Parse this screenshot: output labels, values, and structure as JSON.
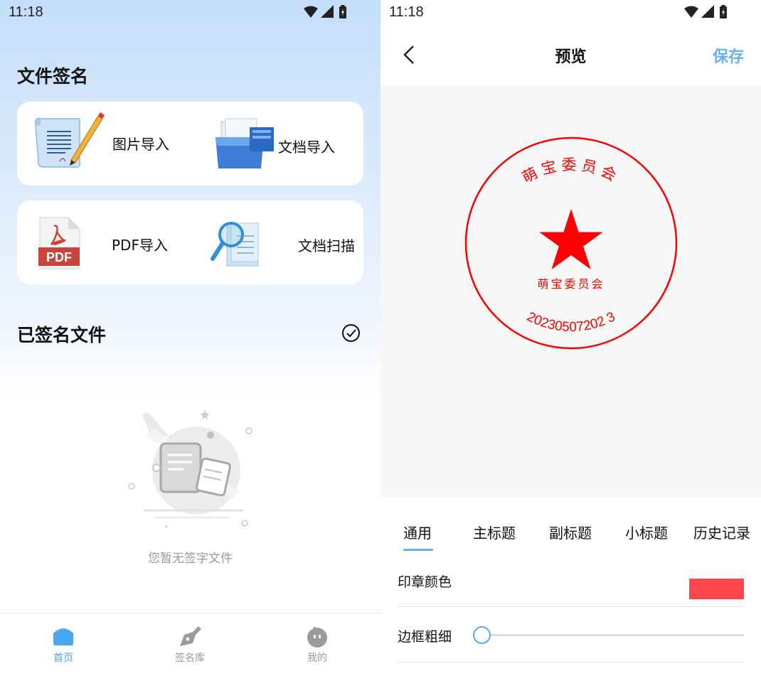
{
  "left": {
    "status": {
      "time": "11:18"
    },
    "file_sign": {
      "title": "文件签名",
      "items": [
        {
          "label": "图片导入",
          "icon": "image-import-icon"
        },
        {
          "label": "文档导入",
          "icon": "folder-import-icon"
        },
        {
          "label": "PDF导入",
          "icon": "pdf-icon"
        },
        {
          "label": "文档扫描",
          "icon": "scan-icon"
        }
      ]
    },
    "signed": {
      "title": "已签名文件",
      "empty_text": "您暂无签字文件"
    },
    "tabbar": {
      "tabs": [
        {
          "label": "首页",
          "icon": "home-icon",
          "active": true
        },
        {
          "label": "签名库",
          "icon": "pen-icon",
          "active": false
        },
        {
          "label": "我的",
          "icon": "profile-icon",
          "active": false
        }
      ]
    },
    "colors": {
      "accent": "#4aa5f3"
    }
  },
  "right": {
    "status": {
      "time": "11:18"
    },
    "header": {
      "title": "预览",
      "save": "保存"
    },
    "seal": {
      "top_text": "萌宝委员会",
      "center_text": "萌宝委员会",
      "bottom_text": "20230507202 3",
      "color": "#ff0000"
    },
    "settings": {
      "tabs": [
        "通用",
        "主标题",
        "副标题",
        "小标题",
        "历史记录"
      ],
      "active_tab": 0,
      "rows": [
        {
          "label": "印章颜色",
          "value_color": "#ff474d"
        },
        {
          "label": "边框粗细"
        }
      ]
    }
  }
}
